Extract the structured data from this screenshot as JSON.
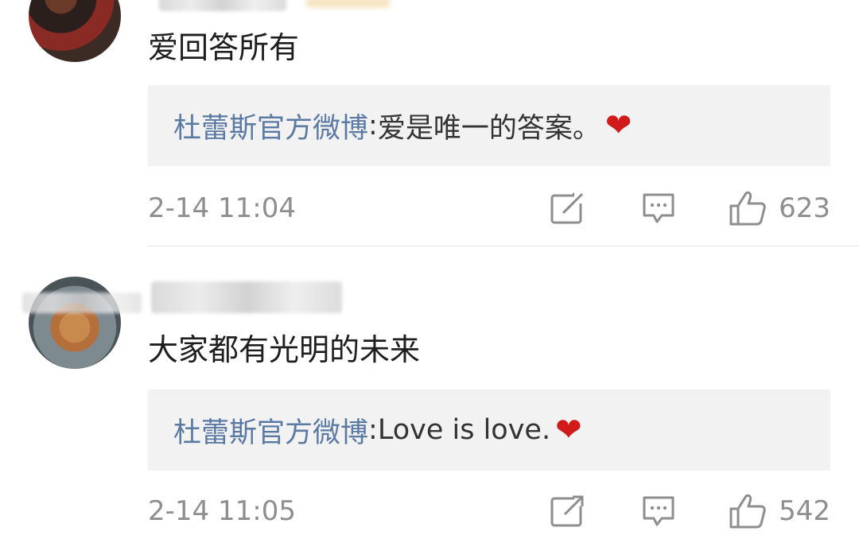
{
  "comments": [
    {
      "text": "爱回答所有",
      "reply": {
        "author": "杜蕾斯官方微博",
        "separator": ": ",
        "text": "爱是唯一的答案。",
        "emoji": "❤"
      },
      "time": "2-14 11:04",
      "likes": "623"
    },
    {
      "text": "大家都有光明的未来",
      "reply": {
        "author": "杜蕾斯官方微博",
        "separator": ": ",
        "text": "Love is love.",
        "emoji": "❤"
      },
      "time": "2-14 11:05",
      "likes": "542"
    }
  ],
  "icons": [
    "share-icon",
    "comment-icon",
    "like-icon"
  ],
  "colors": {
    "author_link": "#5b7aa3",
    "heart": "#d11a1a",
    "reply_bg": "#f2f2f2",
    "meta_gray": "#8e8e8e"
  }
}
